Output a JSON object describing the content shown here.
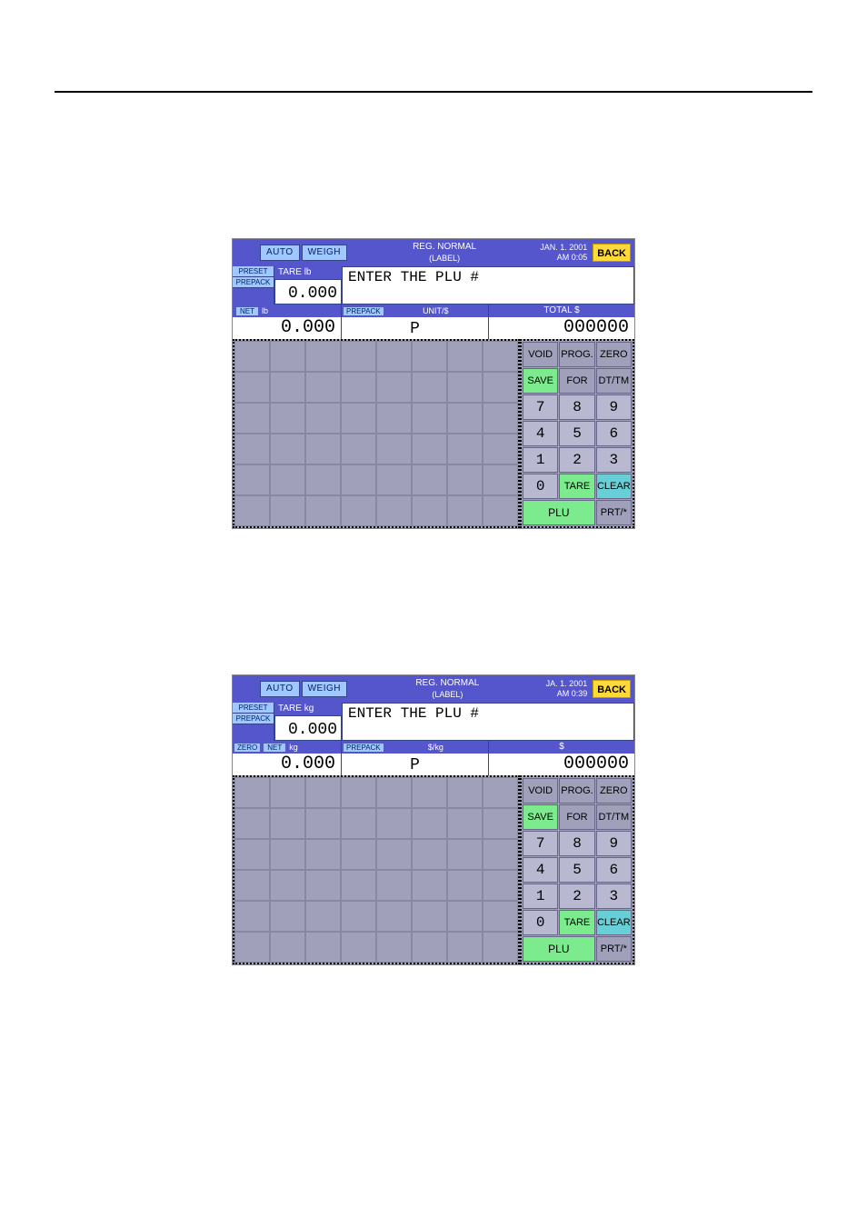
{
  "header": {
    "auto": "AUTO",
    "weigh": "WEIGH",
    "reg_line1": "REG. NORMAL",
    "reg_line2": "(LABEL)",
    "back": "BACK"
  },
  "row2": {
    "preset": "PRESET",
    "prepack": "PREPACK",
    "tare_label_lb": "TARE  lb",
    "tare_label_kg": "TARE  kg",
    "tare_value": "0.000",
    "plu_prompt": "ENTER THE PLU #"
  },
  "row3": {
    "zero_pill": "ZERO",
    "net_pill": "NET",
    "unit_lb": "lb",
    "unit_kg": "kg",
    "net_value": "0.000",
    "prepack_pill": "PREPACK",
    "unit_price_lb": "UNIT/$",
    "unit_price_kg": "$/kg",
    "unit_price_value": "P",
    "total_label_lb": "TOTAL $",
    "total_label_kg": "$",
    "total_value": "000000"
  },
  "datetime_lb": {
    "date": "JAN. 1. 2001",
    "time": "AM 0:05"
  },
  "datetime_kg": {
    "date": "JA. 1. 2001",
    "time": "AM 0:39"
  },
  "keys": {
    "void": "VOID",
    "prog": "PROG.",
    "zero": "ZERO",
    "save": "SAVE",
    "for": "FOR",
    "dttm": "DT/TM",
    "k7": "7",
    "k8": "8",
    "k9": "9",
    "k4": "4",
    "k5": "5",
    "k6": "6",
    "k1": "1",
    "k2": "2",
    "k3": "3",
    "k0": "0",
    "tare": "TARE",
    "clear": "CLEAR",
    "plu": "PLU",
    "prt": "PRT/*"
  }
}
